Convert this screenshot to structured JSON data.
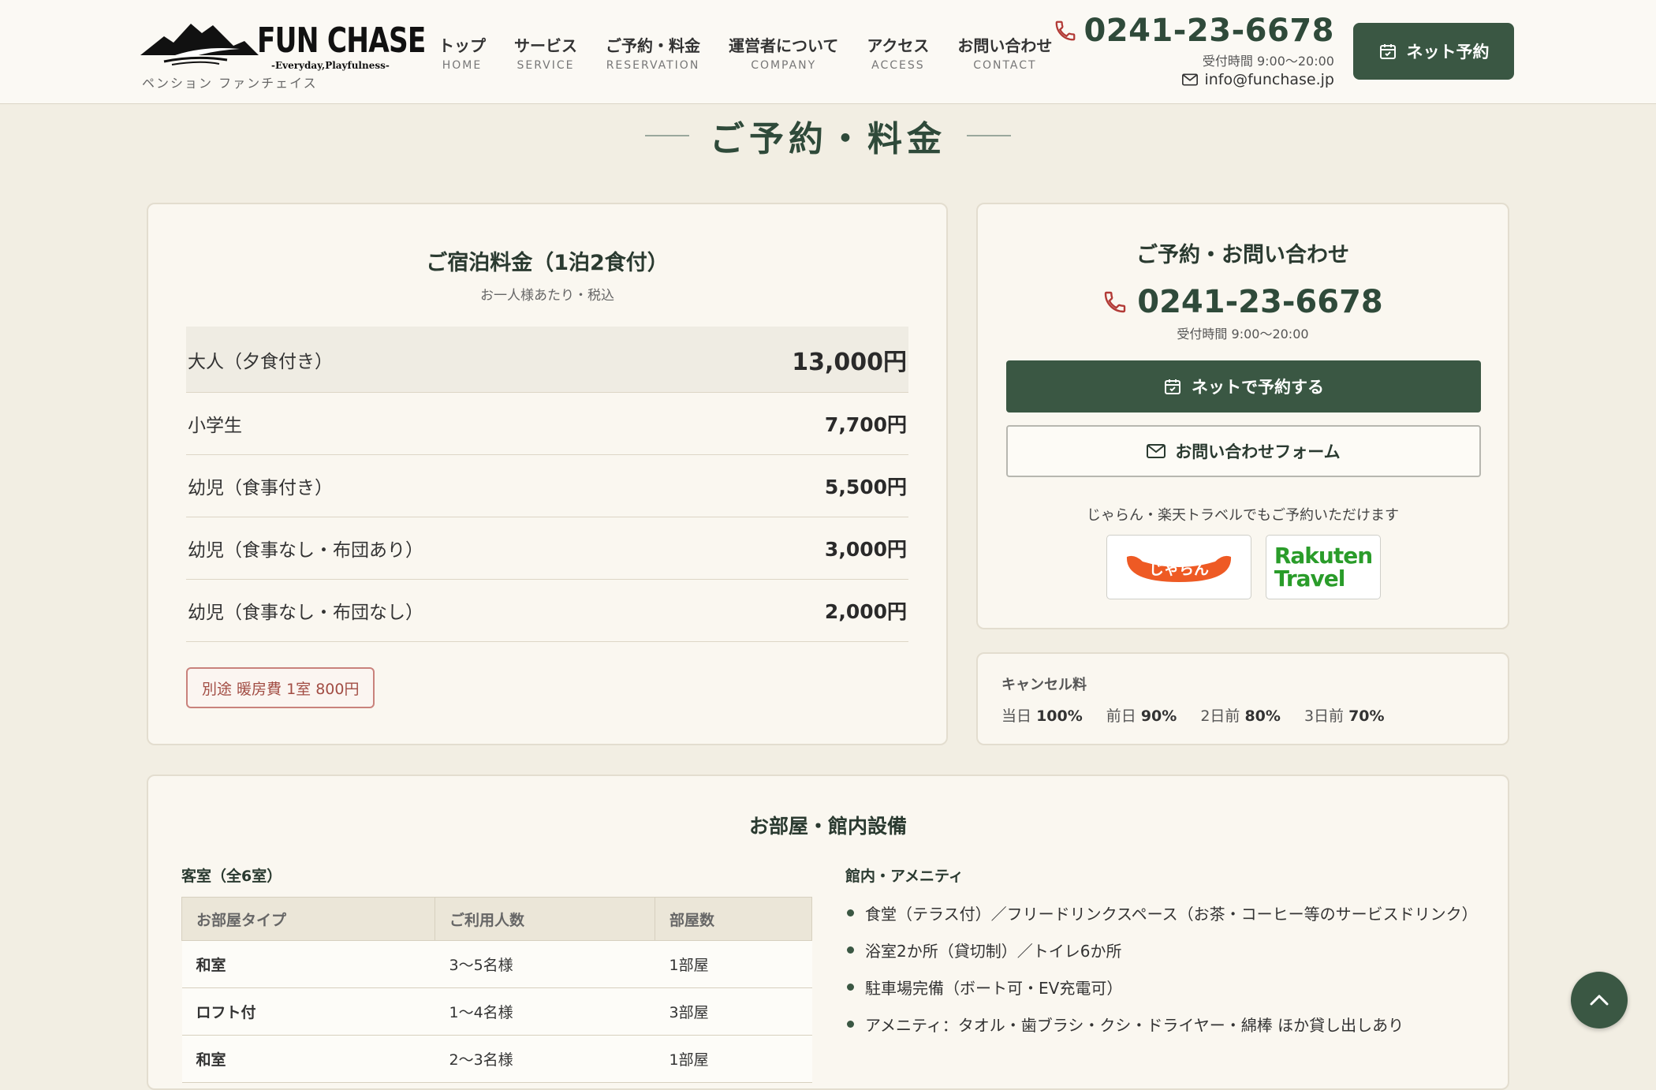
{
  "header": {
    "logo_text": "FUN CHASE",
    "logo_tagline": "-Everyday,Playfulness-",
    "logo_sub": "ペンション ファンチェイス",
    "nav": [
      {
        "jp": "トップ",
        "en": "HOME"
      },
      {
        "jp": "サービス",
        "en": "SERVICE"
      },
      {
        "jp": "ご予約・料金",
        "en": "RESERVATION"
      },
      {
        "jp": "運営者について",
        "en": "COMPANY"
      },
      {
        "jp": "アクセス",
        "en": "ACCESS"
      },
      {
        "jp": "お問い合わせ",
        "en": "CONTACT"
      }
    ],
    "phone": "0241-23-6678",
    "hours": "受付時間 9:00〜20:00",
    "email": "info@funchase.jp",
    "book_button": "ネット予約"
  },
  "section_title": "ご予約・料金",
  "price_card": {
    "title": "ご宿泊料金（1泊2食付）",
    "note": "お一人様あたり・税込",
    "rows": [
      {
        "label": "大人（夕食付き）",
        "value": "13,000円"
      },
      {
        "label": "小学生",
        "value": "7,700円"
      },
      {
        "label": "幼児（食事付き）",
        "value": "5,500円"
      },
      {
        "label": "幼児（食事なし・布団あり）",
        "value": "3,000円"
      },
      {
        "label": "幼児（食事なし・布団なし）",
        "value": "2,000円"
      }
    ],
    "heating": "別途 暖房費 1室 800円"
  },
  "contact_card": {
    "title": "ご予約・お問い合わせ",
    "phone": "0241-23-6678",
    "hours": "受付時間 9:00〜20:00",
    "net_button": "ネットで予約する",
    "form_button": "お問い合わせフォーム",
    "ota_note": "じゃらん・楽天トラベルでもご予約いただけます",
    "jalan_logo": "じゃらん",
    "rakuten_line1": "Rakuten",
    "rakuten_line2": "Travel"
  },
  "cancel_card": {
    "title": "キャンセル料",
    "items": [
      {
        "label": "当日",
        "value": "100%"
      },
      {
        "label": "前日",
        "value": "90%"
      },
      {
        "label": "2日前",
        "value": "80%"
      },
      {
        "label": "3日前",
        "value": "70%"
      }
    ]
  },
  "rooms_card": {
    "title": "お部屋・館内設備",
    "rooms_sub": "客室（全6室）",
    "table_headers": [
      "お部屋タイプ",
      "ご利用人数",
      "部屋数"
    ],
    "table_rows": [
      [
        "和室",
        "3〜5名様",
        "1部屋"
      ],
      [
        "ロフト付",
        "1〜4名様",
        "3部屋"
      ],
      [
        "和室",
        "2〜3名様",
        "1部屋"
      ]
    ],
    "amen_sub": "館内・アメニティ",
    "amenities": [
      "食堂（テラス付）／フリードリンクスペース（お茶・コーヒー等のサービスドリンク）",
      "浴室2か所（貸切制）／トイレ6か所",
      "駐車場完備（ボート可・EV充電可）",
      "アメニティ：タオル・歯ブラシ・クシ・ドライヤー・綿棒 ほか貸し出しあり"
    ]
  },
  "colors": {
    "accent_green": "#3a5743",
    "phone_red": "#b23a36",
    "background": "#f2eee3"
  }
}
